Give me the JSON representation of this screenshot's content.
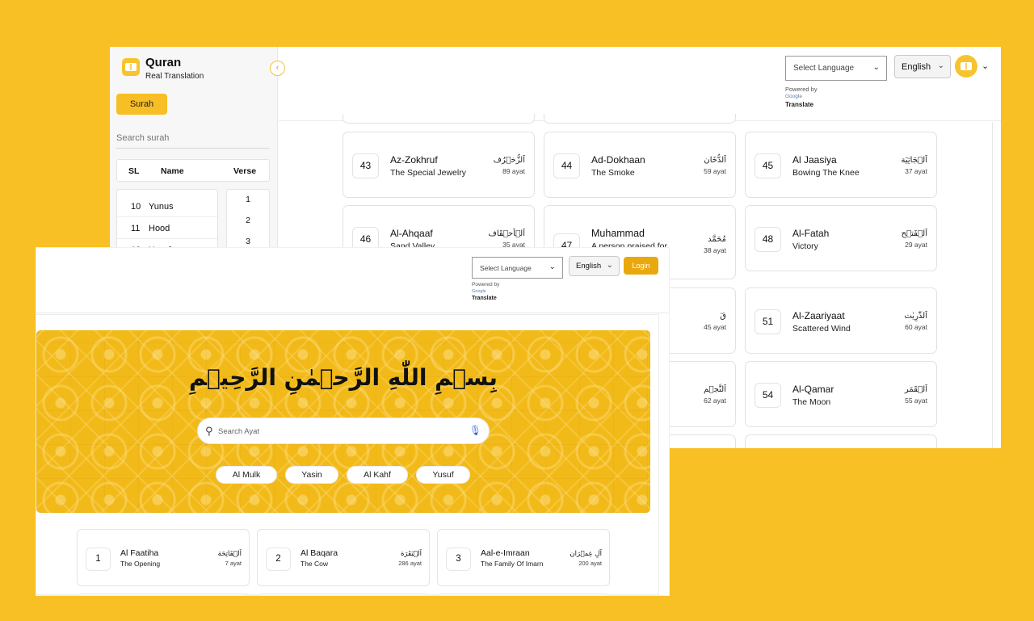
{
  "back_window": {
    "app_title": "Quran",
    "app_subtitle": "Real Translation",
    "collapse_icon": "chevron-left-icon",
    "surah_button": "Surah",
    "sidebar_search_placeholder": "Search surah",
    "table_headers": {
      "sl": "SL",
      "name": "Name",
      "verse": "Verse"
    },
    "sidebar_rows": [
      {
        "sl": "10",
        "name": "Yunus"
      },
      {
        "sl": "11",
        "name": "Hood"
      },
      {
        "sl": "12",
        "name": "Yusuf"
      }
    ],
    "verse_numbers": [
      "1",
      "2",
      "3"
    ],
    "language_select": "Select Language",
    "powered_by": "Powered by",
    "google": "Google",
    "translate": "Translate",
    "english_select": "English",
    "cards": [
      {
        "num": "43",
        "name": "Az-Zokhruf",
        "translation": "The Special Jewelry",
        "arabic": "اَلزُّخۡرُف",
        "ayat": "89 ayat"
      },
      {
        "num": "44",
        "name": "Ad-Dokhaan",
        "translation": "The Smoke",
        "arabic": "اَلدُّخَان",
        "ayat": "59 ayat"
      },
      {
        "num": "45",
        "name": "Al Jaasiya",
        "translation": "Bowing The Knee",
        "arabic": "اَلۡجَاثِيَة",
        "ayat": "37 ayat"
      },
      {
        "num": "46",
        "name": "Al-Ahqaaf",
        "translation": "Sand Valley",
        "arabic": "اَلۡاَحۡقَاف",
        "ayat": "35 ayat"
      },
      {
        "num": "47",
        "name": "Muhammad",
        "translation": "A person praised for",
        "arabic": "مُحَمَّد",
        "ayat": "38 ayat"
      },
      {
        "num": "48",
        "name": "Al-Fatah",
        "translation": "Victory",
        "arabic": "اَلۡفَتۡح",
        "ayat": "29 ayat"
      },
      {
        "num": "",
        "name": "",
        "translation": "",
        "arabic": "قٓ",
        "ayat": "45 ayat"
      },
      {
        "num": "51",
        "name": "Al-Zaariyaat",
        "translation": "Scattered Wind",
        "arabic": "اَلذّٰرِیٰت",
        "ayat": "60 ayat"
      },
      {
        "num": "",
        "name": "",
        "translation": "",
        "arabic": "اَلنَّجۡم",
        "ayat": "62 ayat"
      },
      {
        "num": "54",
        "name": "Al-Qamar",
        "translation": "The Moon",
        "arabic": "اَلۡقَمَر",
        "ayat": "55 ayat"
      }
    ]
  },
  "front_window": {
    "language_select": "Select Language",
    "powered_by": "Powered by",
    "google": "Google",
    "translate": "Translate",
    "english_select": "English",
    "login_button": "Login",
    "bismillah": "بِسۡمِ اللّٰهِ الرَّحۡمٰنِ الرَّحِیۡمِ",
    "search_placeholder": "Search Ayat",
    "chips": [
      "Al Mulk",
      "Yasin",
      "Al Kahf",
      "Yusuf"
    ],
    "cards": [
      {
        "num": "1",
        "name": "Al Faatiha",
        "translation": "The Opening",
        "arabic": "اَلۡفَاتِحَة",
        "ayat": "7 ayat"
      },
      {
        "num": "2",
        "name": "Al Baqara",
        "translation": "The Cow",
        "arabic": "اَلۡبَقَرَة",
        "ayat": "286 ayat"
      },
      {
        "num": "3",
        "name": "Aal-e-Imraan",
        "translation": "The Family Of Imarn",
        "arabic": "آلِ عِمۡرَان",
        "ayat": "200 ayat"
      }
    ]
  },
  "colors": {
    "background": "#f8c024",
    "accent": "#f7bf25",
    "login": "#eaa80f"
  }
}
